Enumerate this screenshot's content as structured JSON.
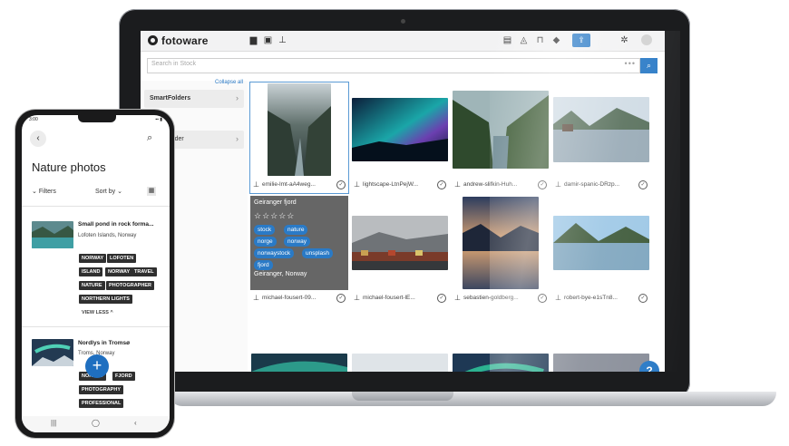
{
  "laptop": {
    "app": {
      "logo_text": "fotoware",
      "header_icons": [
        "folder-icon",
        "briefcase-icon",
        "pin-icon",
        "book-icon",
        "bell-icon",
        "cart-icon",
        "graduation-cap-icon",
        "upload-icon",
        "gear-icon",
        "user-icon"
      ],
      "search": {
        "placeholder": "Search in Stock",
        "options_glyph": "•••"
      },
      "sidebar": {
        "collapse_all": "Collapse all",
        "items": [
          {
            "label": "SmartFolders"
          },
          {
            "label": "oto Provider"
          }
        ]
      },
      "tiles": [
        {
          "name": "emilie-lmt-aA4weg...",
          "selected": true
        },
        {
          "name": "lightscape-LtnPejW..."
        },
        {
          "name": "andrew-slifkin-Huh..."
        },
        {
          "name": "damir-spanic-DRzp..."
        },
        {
          "name": "michael-fousert-09..."
        },
        {
          "name": "michael-fousert-lE..."
        },
        {
          "name": "sebastien-goldberg..."
        },
        {
          "name": "robert-bye-e1sTn8..."
        },
        {
          "name": ""
        },
        {
          "name": ""
        },
        {
          "name": ""
        },
        {
          "name": ""
        }
      ],
      "overlay": {
        "title": "Geiranger fjord",
        "stars": "☆☆☆☆☆",
        "tags": [
          "stock",
          "nature",
          "norge",
          "norway",
          "norwaystock",
          "unsplash",
          "fjord"
        ],
        "location": "Geiranger, Norway"
      },
      "help_glyph": "?"
    }
  },
  "phone": {
    "status": {
      "time": "3:00",
      "right": "▪▪ ▮"
    },
    "title": "Nature photos",
    "filters_label": "Filters",
    "sort_label": "Sort by",
    "items": [
      {
        "title": "Small pond in rock forma...",
        "subtitle": "Lofoten Islands, Norway",
        "tags": [
          "NORWAY",
          "LOFOTEN",
          "ISLAND",
          "NORWAY",
          "TRAVEL",
          "NATURE",
          "PHOTOGRAPHER",
          "NORTHERN LIGHTS"
        ],
        "toggle": "VIEW LESS"
      },
      {
        "title": "Nordlys in Tromsø",
        "subtitle": "Troms, Norway",
        "tags": [
          "NORWAY",
          "FJORD",
          "PHOTOGRAPHY",
          "PROFESSIONAL"
        ]
      }
    ],
    "fab_glyph": "+",
    "nav": [
      "|||",
      "◯",
      "‹"
    ]
  }
}
